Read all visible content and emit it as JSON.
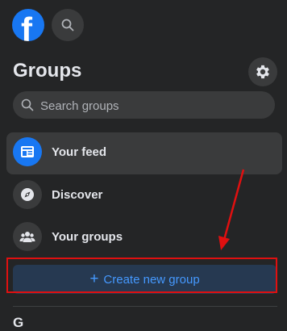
{
  "header": {
    "logo_icon": "facebook-logo",
    "logo_letter": "f",
    "search_icon": "search-icon"
  },
  "sidebar": {
    "title": "Groups",
    "settings_icon": "gear-icon",
    "search": {
      "placeholder": "Search groups",
      "value": ""
    },
    "items": [
      {
        "label": "Your feed",
        "icon": "feed-icon",
        "active": true
      },
      {
        "label": "Discover",
        "icon": "compass-icon",
        "active": false
      },
      {
        "label": "Your groups",
        "icon": "groups-icon",
        "active": false
      }
    ],
    "create_button": {
      "label": "Create new group",
      "icon": "plus-icon"
    },
    "next_section_heading": "G"
  },
  "annotations": {
    "highlight_color": "#e01010",
    "arrow_color": "#e01010"
  },
  "colors": {
    "background": "#242526",
    "accent": "#1877f2",
    "create_button_bg": "#263951",
    "create_button_text": "#4599ff"
  }
}
